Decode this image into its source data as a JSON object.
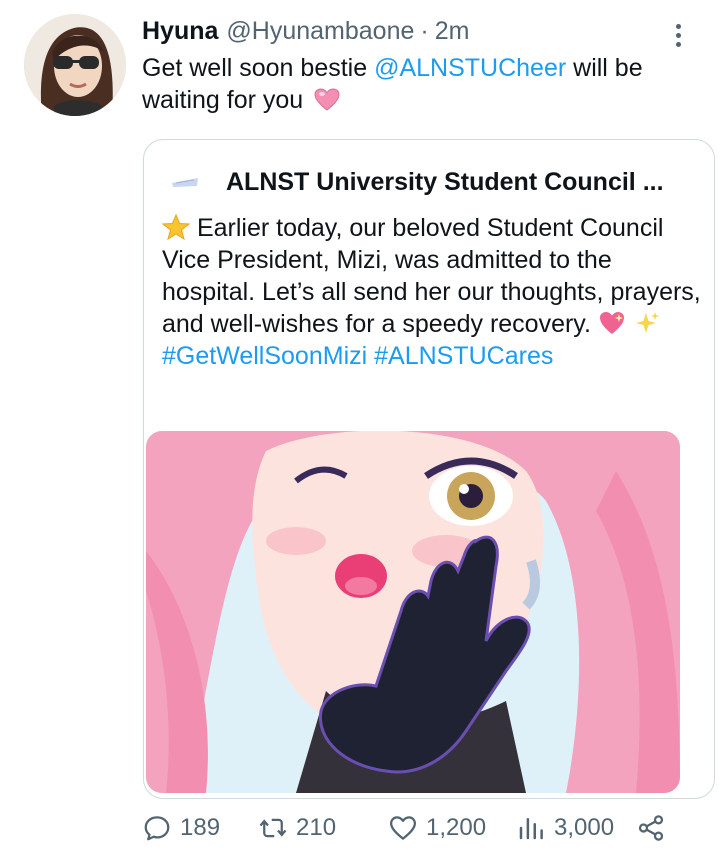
{
  "tweet": {
    "display_name": "Hyuna",
    "handle": "@Hyunambaone",
    "separator": "·",
    "time": "2m",
    "text_before_mention": "Get well soon bestie ",
    "mention": "@ALNSTUCheer",
    "text_after_mention": " will be waiting for you"
  },
  "quote": {
    "author_name": "ALNST University Student Council ...",
    "text": "Earlier today, our beloved Student Council Vice President, Mizi, was admitted to the hospital. Let’s all send her our thoughts, prayers, and well-wishes for a speedy recovery.",
    "hashtag_1": "#GetWellSoonMizi",
    "hashtag_2": "#ALNSTUCares"
  },
  "actions": {
    "replies": "189",
    "retweets": "210",
    "likes": "1,200",
    "views": "3,000"
  },
  "icons": {
    "more": "more-vertical-icon",
    "reply": "reply-icon",
    "retweet": "retweet-icon",
    "like": "heart-icon",
    "views": "views-icon",
    "share": "share-icon"
  },
  "colors": {
    "link": "#1d9bf0",
    "muted": "#536471",
    "text": "#0f1419",
    "border": "#cfd9de"
  }
}
